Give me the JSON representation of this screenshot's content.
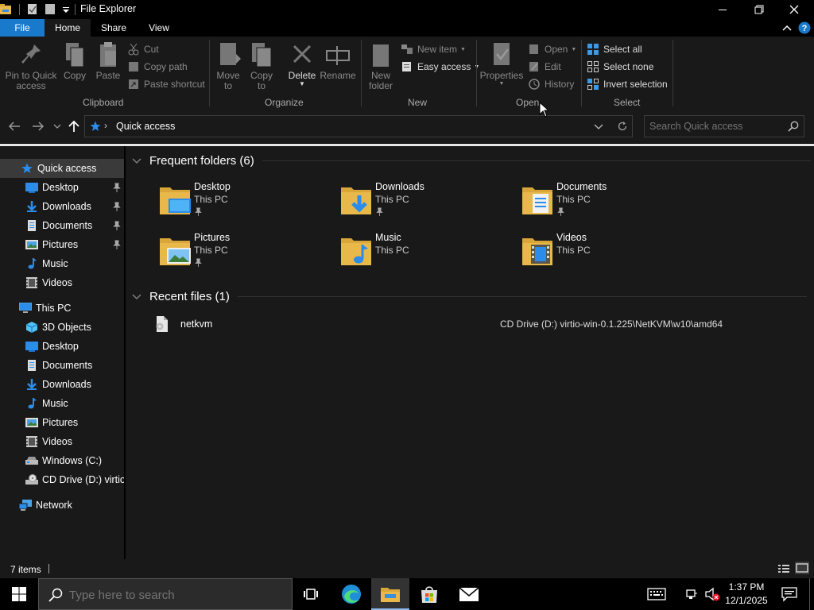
{
  "window": {
    "title": "File Explorer"
  },
  "tabs": {
    "file": "File",
    "home": "Home",
    "share": "Share",
    "view": "View"
  },
  "ribbon": {
    "clipboard": {
      "pin_label_1": "Pin to Quick",
      "pin_label_2": "access",
      "copy": "Copy",
      "paste": "Paste",
      "cut": "Cut",
      "copy_path": "Copy path",
      "paste_shortcut": "Paste shortcut",
      "group": "Clipboard"
    },
    "organize": {
      "move_to_1": "Move",
      "move_to_2": "to",
      "copy_to_1": "Copy",
      "copy_to_2": "to",
      "delete": "Delete",
      "rename": "Rename",
      "group": "Organize"
    },
    "new": {
      "new_folder_1": "New",
      "new_folder_2": "folder",
      "new_item": "New item",
      "easy_access": "Easy access",
      "group": "New"
    },
    "open": {
      "properties": "Properties",
      "open": "Open",
      "edit": "Edit",
      "history": "History",
      "group": "Open"
    },
    "select": {
      "select_all": "Select all",
      "select_none": "Select none",
      "invert_selection": "Invert selection",
      "group": "Select"
    }
  },
  "address": {
    "path": "Quick access",
    "search_placeholder": "Search Quick access"
  },
  "nav": {
    "quick_access": "Quick access",
    "qa_items": [
      "Desktop",
      "Downloads",
      "Documents",
      "Pictures",
      "Music",
      "Videos"
    ],
    "this_pc": "This PC",
    "pc_items": [
      "3D Objects",
      "Desktop",
      "Documents",
      "Downloads",
      "Music",
      "Pictures",
      "Videos",
      "Windows (C:)",
      "CD Drive (D:) virtio-"
    ],
    "network": "Network"
  },
  "content": {
    "frequent_header": "Frequent folders (6)",
    "folders": [
      {
        "name": "Desktop",
        "location": "This PC",
        "pinned": true
      },
      {
        "name": "Downloads",
        "location": "This PC",
        "pinned": true
      },
      {
        "name": "Documents",
        "location": "This PC",
        "pinned": true
      },
      {
        "name": "Pictures",
        "location": "This PC",
        "pinned": true
      },
      {
        "name": "Music",
        "location": "This PC",
        "pinned": false
      },
      {
        "name": "Videos",
        "location": "This PC",
        "pinned": false
      }
    ],
    "recent_header": "Recent files (1)",
    "recent_files": [
      {
        "name": "netkvm",
        "path": "CD Drive (D:) virtio-win-0.1.225\\NetKVM\\w10\\amd64"
      }
    ]
  },
  "status": {
    "items": "7 items"
  },
  "taskbar": {
    "search_placeholder": "Type here to search",
    "time": "1:37 PM",
    "date": "12/1/2025"
  },
  "colors": {
    "accent": "#1979ca",
    "folder_yellow": "#e8b84a",
    "background": "#191919"
  }
}
